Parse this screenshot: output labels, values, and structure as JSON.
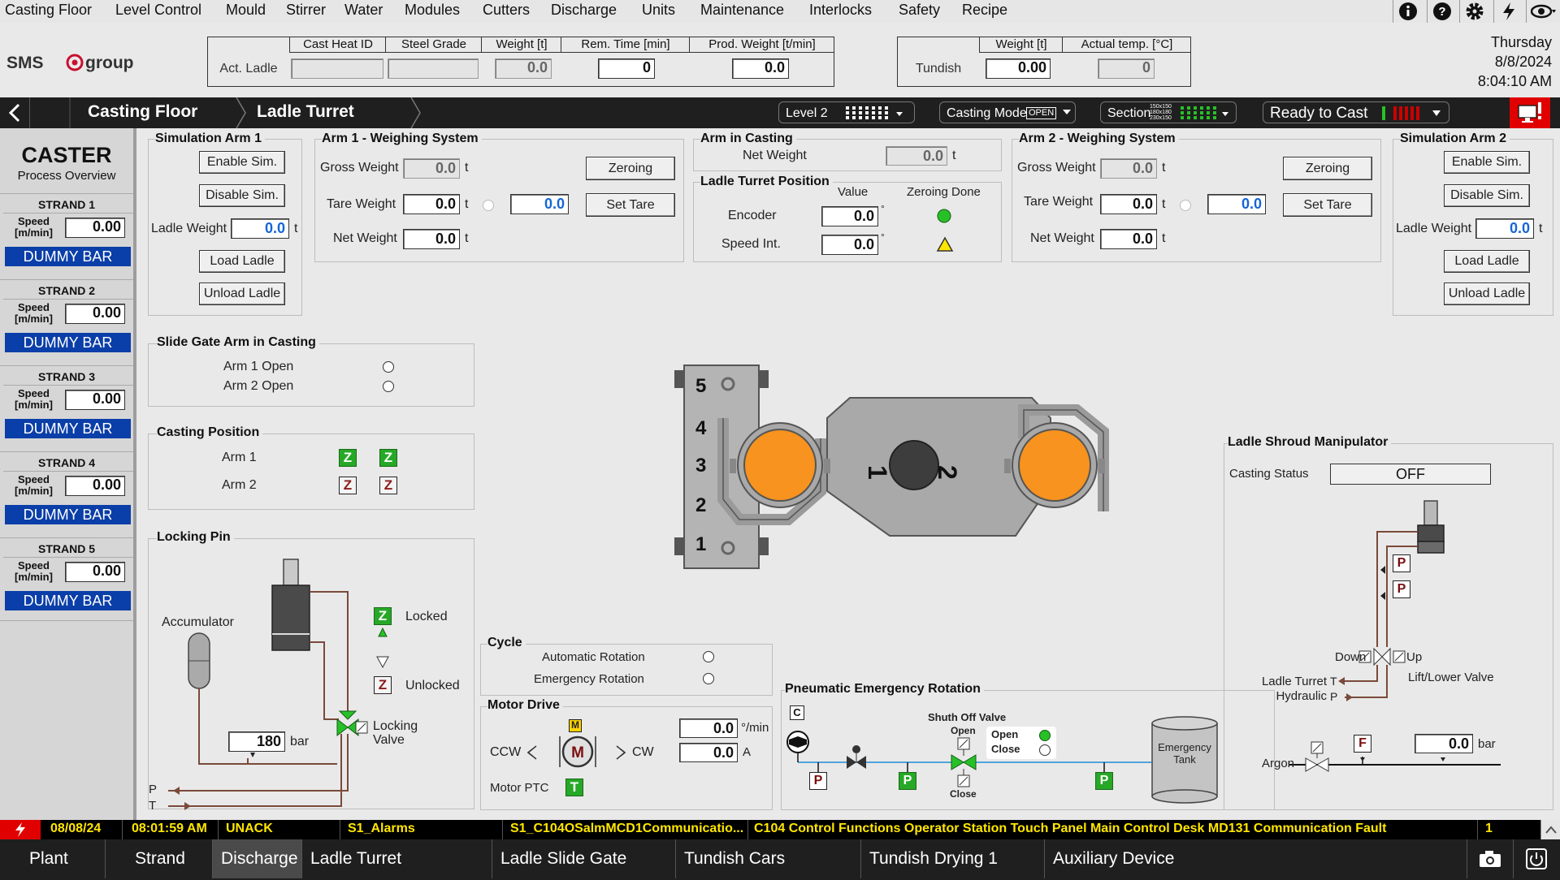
{
  "menu": [
    "Casting Floor",
    "Level Control",
    "Mould",
    "Stirrer",
    "Water",
    "Modules",
    "Cutters",
    "Discharge",
    "Units",
    "Maintenance",
    "Interlocks",
    "Safety",
    "Recipe"
  ],
  "brand": {
    "logo_text": "SMS group"
  },
  "datetime": {
    "day": "Thursday",
    "date": "8/8/2024",
    "time": "8:04:10 AM"
  },
  "ladle_header": {
    "row_label": "Act. Ladle",
    "columns": [
      "Cast Heat ID",
      "Steel Grade",
      "Weight [t]",
      "Rem. Time [min]",
      "Prod. Weight [t/min]"
    ],
    "weight": "0.0",
    "rem_time": "0",
    "prod_weight": "0.0"
  },
  "tundish_header": {
    "row_label": "Tundish",
    "columns": [
      "Weight [t]",
      "Actual temp. [°C]"
    ],
    "weight": "0.00",
    "temp": "0"
  },
  "nav": {
    "crumbs": [
      "Casting Floor",
      "Ladle Turret"
    ],
    "level": "Level 2",
    "casting_mode_label": "Casting Mode",
    "casting_mode_value": "OPEN",
    "section_label": "Section",
    "section_sizes": [
      "150x150",
      "180x180",
      "230x150"
    ],
    "ready": "Ready to Cast"
  },
  "sidebar": {
    "title": "CASTER",
    "subtitle": "Process Overview",
    "speed_label_1": "Speed",
    "speed_label_2": "[m/min]",
    "dummy_label": "DUMMY BAR",
    "strands": [
      {
        "name": "STRAND 1",
        "speed": "0.00"
      },
      {
        "name": "STRAND 2",
        "speed": "0.00"
      },
      {
        "name": "STRAND 3",
        "speed": "0.00"
      },
      {
        "name": "STRAND 4",
        "speed": "0.00"
      },
      {
        "name": "STRAND 5",
        "speed": "0.00"
      }
    ]
  },
  "sim_arm1": {
    "title": "Simulation Arm 1",
    "enable": "Enable Sim.",
    "disable": "Disable Sim.",
    "ladle_weight_label": "Ladle Weight",
    "ladle_weight": "0.0",
    "unit": "t",
    "load": "Load Ladle",
    "unload": "Unload Ladle"
  },
  "sim_arm2": {
    "title": "Simulation Arm 2",
    "enable": "Enable Sim.",
    "disable": "Disable Sim.",
    "ladle_weight_label": "Ladle Weight",
    "ladle_weight": "0.0",
    "unit": "t",
    "load": "Load Ladle",
    "unload": "Unload Ladle"
  },
  "weigh_arm1": {
    "title": "Arm 1 - Weighing System",
    "gross_label": "Gross Weight",
    "gross": "0.0",
    "tare_label": "Tare Weight",
    "tare": "0.0",
    "tare_input": "0.0",
    "net_label": "Net Weight",
    "net": "0.0",
    "unit": "t",
    "zeroing": "Zeroing",
    "set_tare": "Set Tare"
  },
  "weigh_arm2": {
    "title": "Arm 2 - Weighing System",
    "gross_label": "Gross Weight",
    "gross": "0.0",
    "tare_label": "Tare Weight",
    "tare": "0.0",
    "tare_input": "0.0",
    "net_label": "Net Weight",
    "net": "0.0",
    "unit": "t",
    "zeroing": "Zeroing",
    "set_tare": "Set Tare"
  },
  "arm_in_casting": {
    "title": "Arm in Casting",
    "net_label": "Net Weight",
    "net": "0.0",
    "unit": "t"
  },
  "turret_position": {
    "title": "Ladle Turret Position",
    "col_value": "Value",
    "col_zeroing": "Zeroing Done",
    "encoder_label": "Encoder",
    "encoder": "0.0",
    "speed_label": "Speed Int.",
    "speed": "0.0",
    "deg": "°"
  },
  "slide_gate": {
    "title": "Slide Gate Arm in Casting",
    "arm1": "Arm 1 Open",
    "arm2": "Arm 2 Open"
  },
  "casting_position": {
    "title": "Casting Position",
    "arm1": "Arm 1",
    "arm2": "Arm 2",
    "z": "Z"
  },
  "locking_pin": {
    "title": "Locking Pin",
    "accumulator": "Accumulator",
    "locked": "Locked",
    "unlocked": "Unlocked",
    "valve_1": "Locking",
    "valve_2": "Valve",
    "pressure": "180",
    "pressure_unit": "bar",
    "p_line": "P",
    "t_line": "T",
    "z": "Z"
  },
  "turret_graphic": {
    "positions": [
      "5",
      "4",
      "3",
      "2",
      "1"
    ],
    "arm_labels": [
      "1",
      "2"
    ]
  },
  "cycle": {
    "title": "Cycle",
    "auto": "Automatic Rotation",
    "emergency": "Emergency Rotation"
  },
  "motor": {
    "title": "Motor Drive",
    "ccw": "CCW",
    "cw": "CW",
    "m": "M",
    "m_badge": "M",
    "speed": "0.0",
    "speed_unit": "°/min",
    "current": "0.0",
    "current_unit": "A",
    "ptc_label": "Motor PTC",
    "ptc_badge": "T"
  },
  "pneumatic": {
    "title": "Pneumatic Emergency Rotation",
    "valve_title": "Shuth Off Valve",
    "open": "Open",
    "close": "Close",
    "open_top": "Open",
    "close_bottom": "Close",
    "tank_1": "Emergency",
    "tank_2": "Tank",
    "c_badge": "C",
    "p": "P"
  },
  "shroud": {
    "title": "Ladle Shroud Manipulator",
    "status_label": "Casting Status",
    "status": "OFF",
    "down": "Down",
    "up": "Up",
    "valve": "Lift/Lower Valve",
    "hyd_1": "Ladle Turret",
    "hyd_2": "Hydraulic",
    "t": "T",
    "p": "P",
    "argon": "Argon",
    "f": "F",
    "argon_pressure": "0.0",
    "bar": "bar"
  },
  "alarm": {
    "date": "08/08/24",
    "time": "08:01:59 AM",
    "state": "UNACK",
    "group": "S1_Alarms",
    "tag": "S1_C104OSalmMCD1Communicatio...",
    "message": "C104 Control Functions Operator Station Touch Panel Main Control Desk MD131 Communication Fault",
    "count": "1"
  },
  "tabs": [
    "Plant",
    "Strand",
    "Discharge",
    "Ladle Turret",
    "Ladle Slide Gate",
    "Tundish Cars",
    "Tundish Drying 1",
    "Auxiliary Device"
  ],
  "colors": {
    "accent": "#0a3ea8",
    "ok": "#27a827",
    "ladle": "#f7931e",
    "alarm": "#ffe600"
  }
}
